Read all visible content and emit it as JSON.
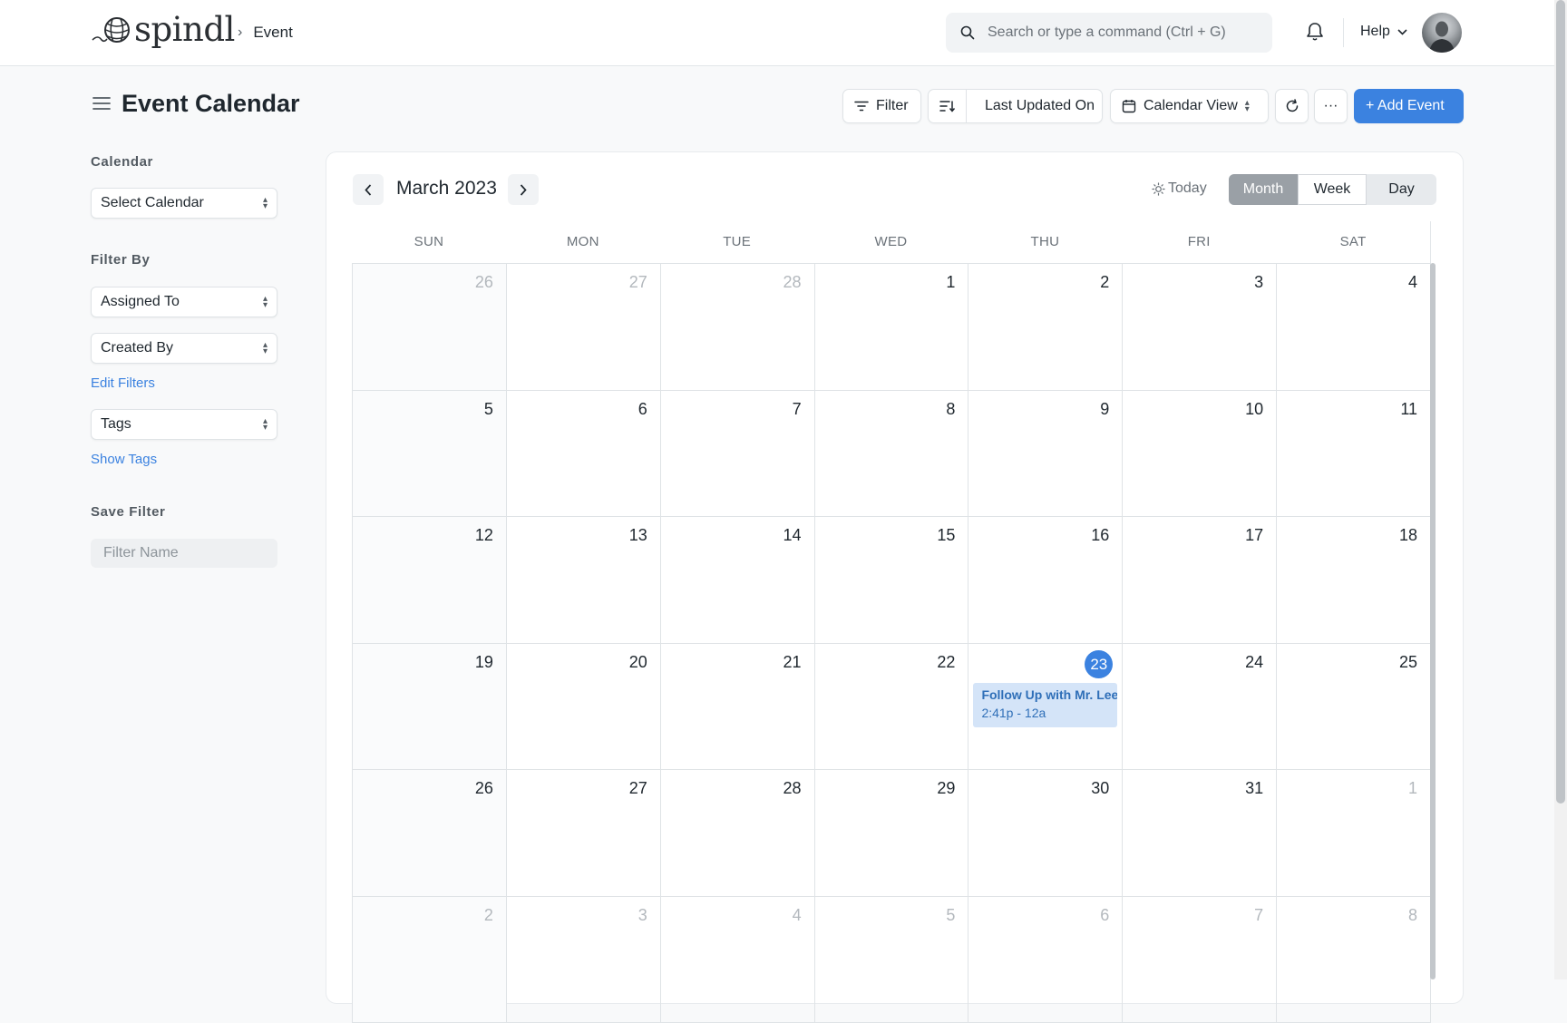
{
  "navbar": {
    "logo_text": "spindl",
    "breadcrumb": "Event",
    "search_placeholder": "Search or type a command (Ctrl + G)",
    "help_label": "Help"
  },
  "header": {
    "title": "Event Calendar",
    "filter_label": "Filter",
    "sort_label": "Last Updated On",
    "view_label": "Calendar View",
    "more_label": "···",
    "add_label": "+ Add Event"
  },
  "sidebar": {
    "calendar_label": "Calendar",
    "calendar_select": "Select Calendar",
    "filter_by_label": "Filter By",
    "assigned_to": "Assigned To",
    "created_by": "Created By",
    "edit_filters": "Edit Filters",
    "tags": "Tags",
    "show_tags": "Show Tags",
    "save_filter_label": "Save Filter",
    "filter_name_placeholder": "Filter Name"
  },
  "calendar": {
    "month_title": "March 2023",
    "today_label": "Today",
    "views": [
      "Month",
      "Week",
      "Day"
    ],
    "active_view": "Month",
    "weekdays": [
      "SUN",
      "MON",
      "TUE",
      "WED",
      "THU",
      "FRI",
      "SAT"
    ],
    "weeks": [
      [
        {
          "d": "26",
          "o": true
        },
        {
          "d": "27",
          "o": true
        },
        {
          "d": "28",
          "o": true
        },
        {
          "d": "1"
        },
        {
          "d": "2"
        },
        {
          "d": "3"
        },
        {
          "d": "4"
        }
      ],
      [
        {
          "d": "5"
        },
        {
          "d": "6"
        },
        {
          "d": "7"
        },
        {
          "d": "8"
        },
        {
          "d": "9"
        },
        {
          "d": "10"
        },
        {
          "d": "11"
        }
      ],
      [
        {
          "d": "12"
        },
        {
          "d": "13"
        },
        {
          "d": "14"
        },
        {
          "d": "15"
        },
        {
          "d": "16"
        },
        {
          "d": "17"
        },
        {
          "d": "18"
        }
      ],
      [
        {
          "d": "19"
        },
        {
          "d": "20"
        },
        {
          "d": "21"
        },
        {
          "d": "22"
        },
        {
          "d": "23",
          "today": true
        },
        {
          "d": "24"
        },
        {
          "d": "25"
        }
      ],
      [
        {
          "d": "26"
        },
        {
          "d": "27"
        },
        {
          "d": "28"
        },
        {
          "d": "29"
        },
        {
          "d": "30"
        },
        {
          "d": "31"
        },
        {
          "d": "1",
          "o": true
        }
      ],
      [
        {
          "d": "2",
          "o": true
        },
        {
          "d": "3",
          "o": true
        },
        {
          "d": "4",
          "o": true
        },
        {
          "d": "5",
          "o": true
        },
        {
          "d": "6",
          "o": true
        },
        {
          "d": "7",
          "o": true
        },
        {
          "d": "8",
          "o": true
        }
      ]
    ],
    "event": {
      "title": "Follow Up with Mr. Lee",
      "time": "2:41p - 12a",
      "week": 3,
      "day": 4
    }
  },
  "colors": {
    "accent": "#3b82e0",
    "event_bg": "#d4e4f8",
    "event_text": "#2f6fb8"
  }
}
